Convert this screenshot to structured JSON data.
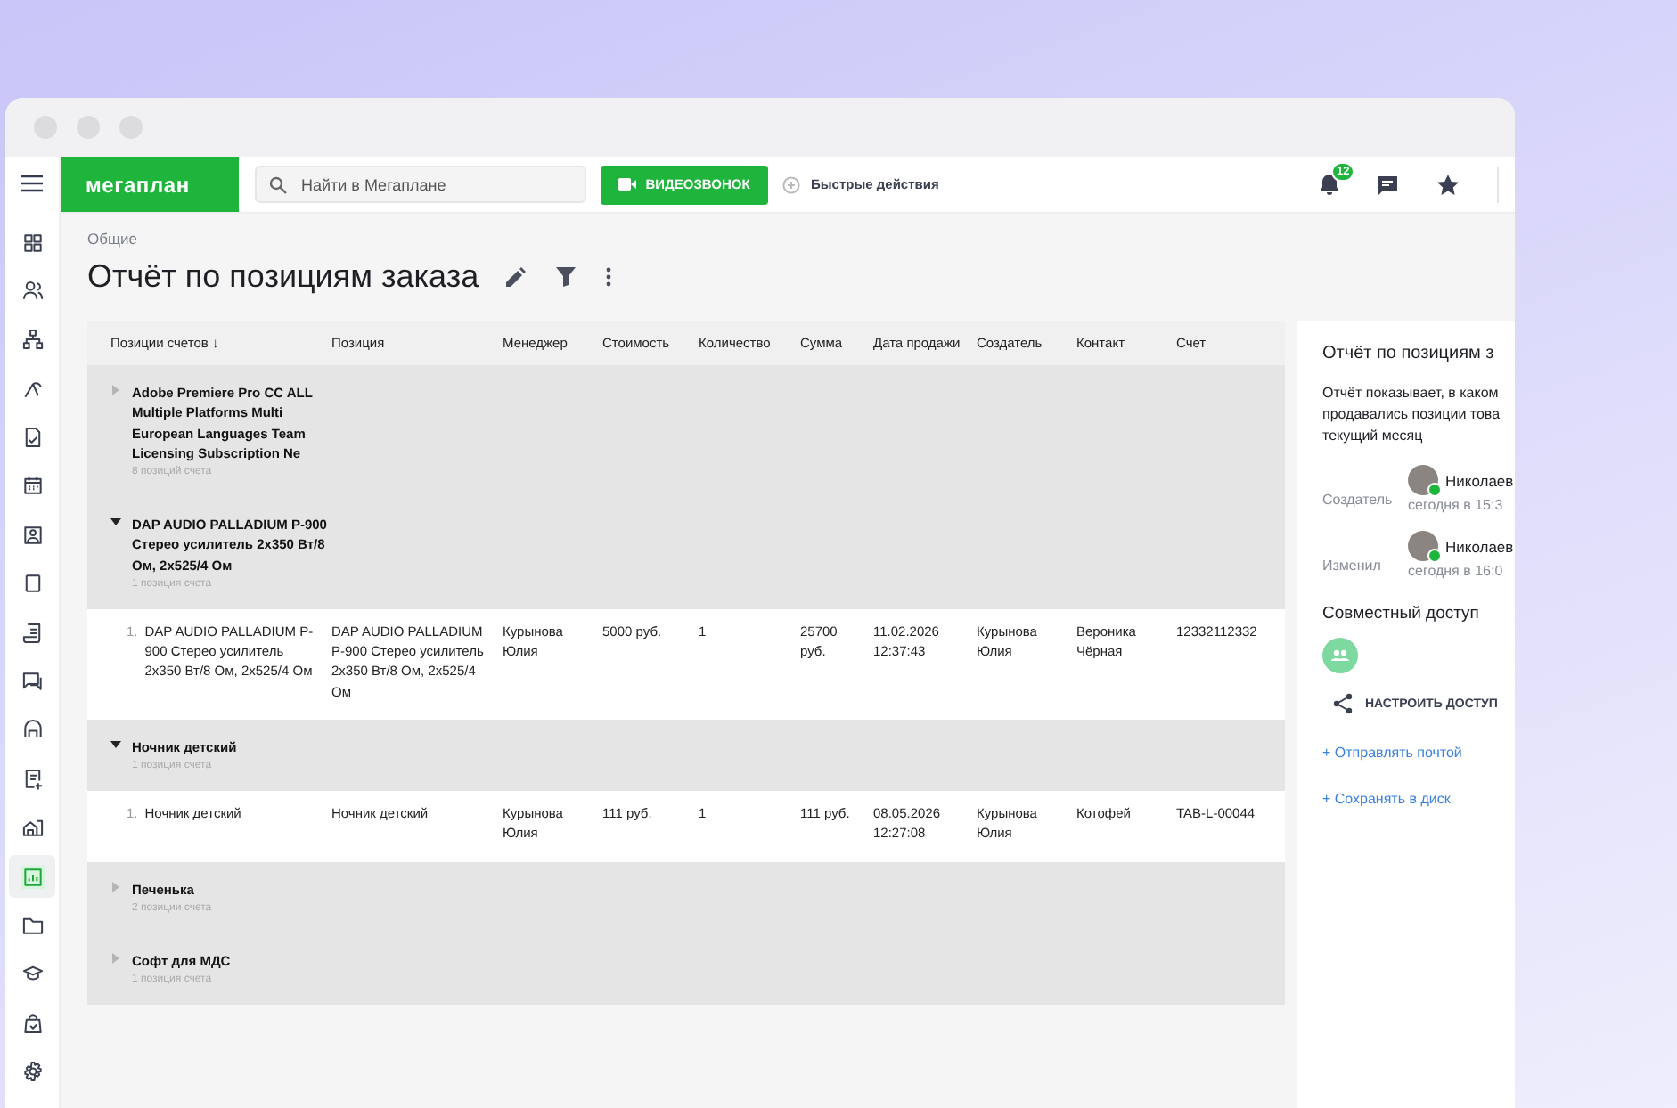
{
  "topbar": {
    "logo": "мегаплан",
    "search": {
      "placeholder": "Найти в Мегаплане"
    },
    "video_button": "ВИДЕОЗВОНОК",
    "quick_actions": "Быстрые действия",
    "notifications": {
      "badge": "12"
    }
  },
  "sidebar": {
    "items": [
      {
        "selected": false
      },
      {
        "selected": false
      },
      {
        "selected": false
      },
      {
        "selected": false
      },
      {
        "selected": false
      },
      {
        "selected": false
      },
      {
        "selected": false
      },
      {
        "selected": false
      },
      {
        "selected": false
      },
      {
        "selected": false
      },
      {
        "selected": false
      },
      {
        "selected": false
      },
      {
        "selected": false
      },
      {
        "selected": true
      },
      {
        "selected": false
      },
      {
        "selected": false
      },
      {
        "selected": false
      },
      {
        "selected": false
      }
    ]
  },
  "page": {
    "breadcrumb": "Общие",
    "title": "Отчёт по позициям заказа"
  },
  "table": {
    "columns": [
      "Позиции счетов ↓",
      "Позиция",
      "Менеджер",
      "Стоимость",
      "Количество",
      "Сумма",
      "Дата продажи",
      "Создатель",
      "Контакт",
      "Счет"
    ],
    "rows": [
      {
        "kind": "group",
        "expanded": false,
        "title": "Adobe Premiere Pro CC ALL Multiple Platforms Multi European Languages Team Licensing Subscription Ne",
        "count": "8 позиций счета"
      },
      {
        "kind": "group",
        "expanded": true,
        "title": "DAP AUDIO PALLADIUM P-900 Стерео усилитель 2x350 Вт/8 Ом, 2x525/4 Ом",
        "count": "1 позиция счета"
      },
      {
        "kind": "item",
        "number": "1.",
        "cells": [
          "DAP AUDIO PALLADIUM P-900 Стерео усилитель 2x350 Вт/8 Ом, 2x525/4 Ом",
          "DAP AUDIO PALLADIUM P-900 Стерео усилитель 2x350 Вт/8 Ом, 2x525/4 Ом",
          "Курынова Юлия",
          "5000 руб.",
          "1",
          "25700 руб.",
          "11.02.2026 12:37:43",
          "Курынова Юлия",
          "Вероника Чёрная",
          "12332112332"
        ]
      },
      {
        "kind": "group",
        "expanded": true,
        "title": "Ночник детский",
        "count": "1 позиция счета"
      },
      {
        "kind": "item",
        "number": "1.",
        "cells": [
          "Ночник детский",
          "Ночник детский",
          "Курынова Юлия",
          "111 руб.",
          "1",
          "111 руб.",
          "08.05.2026 12:27:08",
          "Курынова Юлия",
          "Котофей",
          "TAB-L-00044"
        ]
      },
      {
        "kind": "group",
        "expanded": false,
        "title": "Печенька",
        "count": "2 позиции счета"
      },
      {
        "kind": "group",
        "expanded": false,
        "title": "Софт для МДС",
        "count": "1 позиция счета"
      }
    ]
  },
  "panel": {
    "title": "Отчёт по позициям з",
    "description": [
      "Отчёт показывает, в каком",
      "продавались позиции това",
      "текущий месяц"
    ],
    "people": [
      {
        "label": "Создатель",
        "name": "Николаев",
        "time": "сегодня в 15:3",
        "online": true
      },
      {
        "label": "Изменил",
        "name": "Николаев",
        "time": "сегодня в 16:0",
        "online": true
      }
    ],
    "shared_title": "Совместный доступ",
    "access_button": "НАСТРОИТЬ ДОСТУП",
    "links": [
      "+ Отправлять почтой",
      "+ Сохранять в диск"
    ]
  }
}
